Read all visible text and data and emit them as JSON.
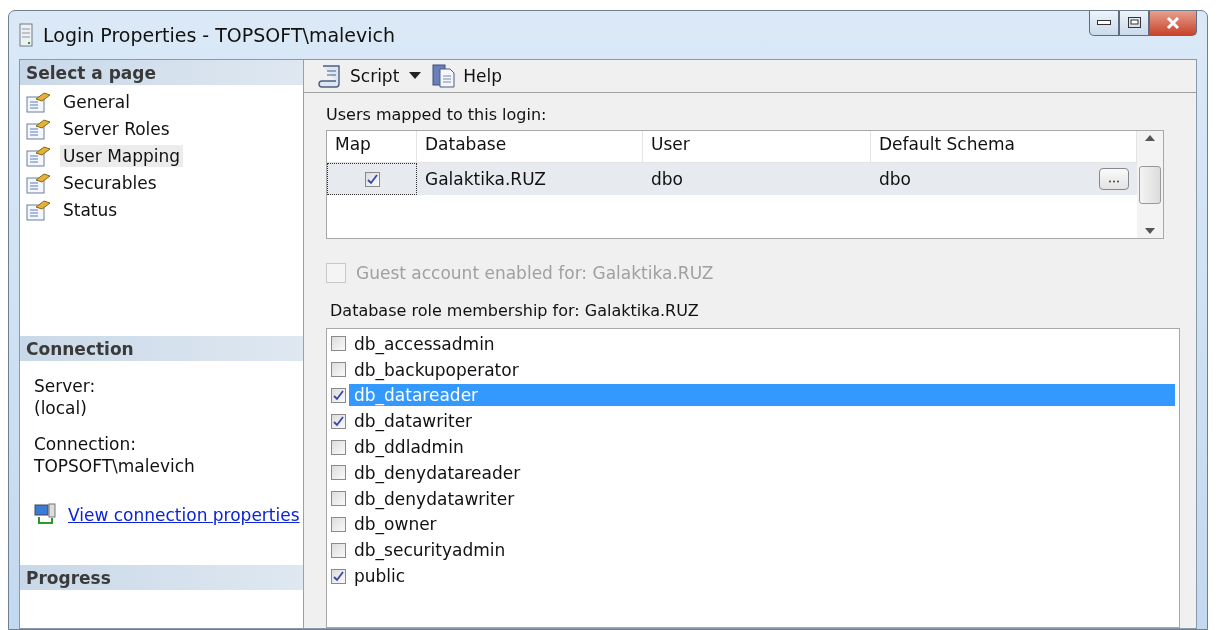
{
  "window": {
    "title": "Login Properties - TOPSOFT\\malevich"
  },
  "sidebar": {
    "header": "Select a page",
    "items": [
      {
        "label": "General",
        "selected": false
      },
      {
        "label": "Server Roles",
        "selected": false
      },
      {
        "label": "User Mapping",
        "selected": true
      },
      {
        "label": "Securables",
        "selected": false
      },
      {
        "label": "Status",
        "selected": false
      }
    ]
  },
  "connection": {
    "header": "Connection",
    "fields": [
      {
        "label": "Server:",
        "value": "(local)"
      },
      {
        "label": "Connection:",
        "value": "TOPSOFT\\malevich"
      }
    ],
    "link": "View connection properties"
  },
  "progress": {
    "header": "Progress"
  },
  "toolbar": [
    {
      "kind": "script",
      "label": "Script"
    },
    {
      "kind": "help",
      "label": "Help"
    }
  ],
  "mapping": {
    "label": "Users mapped to this login:",
    "columns": [
      "Map",
      "Database",
      "User",
      "Default Schema"
    ],
    "rows": [
      {
        "checked": true,
        "database": "Galaktika.RUZ",
        "user": "dbo",
        "schema": "dbo",
        "selected": true
      }
    ]
  },
  "guest": {
    "label": "Guest account enabled for: Galaktika.RUZ",
    "checked": false,
    "disabled": true
  },
  "roles": {
    "label": "Database role membership for: Galaktika.RUZ",
    "items": [
      {
        "name": "db_accessadmin",
        "checked": false,
        "selected": false
      },
      {
        "name": "db_backupoperator",
        "checked": false,
        "selected": false
      },
      {
        "name": "db_datareader",
        "checked": true,
        "selected": true
      },
      {
        "name": "db_datawriter",
        "checked": true,
        "selected": false
      },
      {
        "name": "db_ddladmin",
        "checked": false,
        "selected": false
      },
      {
        "name": "db_denydatareader",
        "checked": false,
        "selected": false
      },
      {
        "name": "db_denydatawriter",
        "checked": false,
        "selected": false
      },
      {
        "name": "db_owner",
        "checked": false,
        "selected": false
      },
      {
        "name": "db_securityadmin",
        "checked": false,
        "selected": false
      },
      {
        "name": "public",
        "checked": true,
        "selected": false
      }
    ]
  }
}
